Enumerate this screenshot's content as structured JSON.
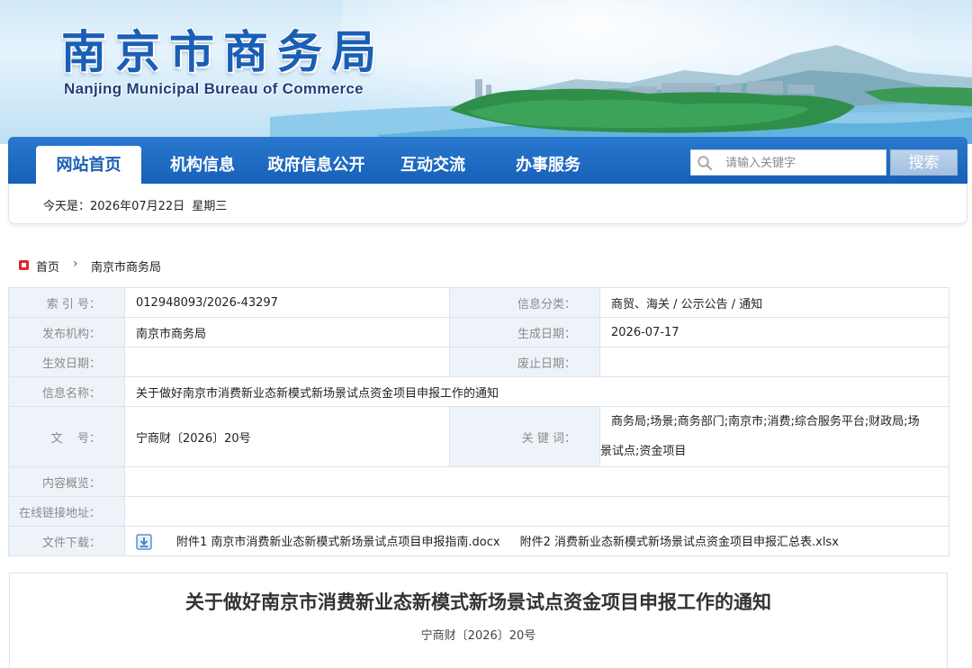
{
  "header": {
    "title_cn": "南京市商务局",
    "title_en": "Nanjing Municipal Bureau of Commerce"
  },
  "nav": {
    "items": [
      {
        "label": "网站首页",
        "active": true
      },
      {
        "label": "机构信息",
        "active": false
      },
      {
        "label": "政府信息公开",
        "active": false
      },
      {
        "label": "互动交流",
        "active": false
      },
      {
        "label": "办事服务",
        "active": false
      }
    ],
    "search_placeholder": "请输入关键字",
    "search_button": "搜索"
  },
  "datebar": {
    "text": "今天是：2026年07月22日  星期三"
  },
  "breadcrumb": {
    "home": "首页",
    "separator": "›",
    "current": "南京市商务局"
  },
  "info": {
    "index_label": "索 引 号：",
    "index_value": "012948093/2026-43297",
    "category_label": "信息分类：",
    "category_value": "商贸、海关 / 公示公告 / 通知",
    "publisher_label": "发布机构：",
    "publisher_value": "南京市商务局",
    "created_label": "生成日期：",
    "created_value": "2026-07-17",
    "effective_label": "生效日期：",
    "effective_value": "",
    "expired_label": "废止日期：",
    "expired_value": "",
    "name_label": "信息名称：",
    "name_value": "关于做好南京市消费新业态新模式新场景试点资金项目申报工作的通知",
    "docno_label": "文    号：",
    "docno_value": "宁商财〔2026〕20号",
    "keywords_label": "关 键 词：",
    "keywords_line1": "商务局;场景;商务部门;南京市;消费;综合服务平台;财政局;场",
    "keywords_line2": "景试点;资金项目",
    "summary_label": "内容概览：",
    "summary_value": "",
    "link_label": "在线链接地址：",
    "link_value": "",
    "download_label": "文件下载：",
    "attachment1": "附件1 南京市消费新业态新模式新场景试点项目申报指南.docx",
    "attachment2": "附件2 消费新业态新模式新场景试点资金项目申报汇总表.xlsx"
  },
  "article": {
    "title": "关于做好南京市消费新业态新模式新场景试点资金项目申报工作的通知",
    "doc_number": "宁商财〔2026〕20号"
  },
  "colors": {
    "nav_blue": "#1a5fb6",
    "label_bg": "#eef3f9",
    "home_red": "#d9272e"
  }
}
